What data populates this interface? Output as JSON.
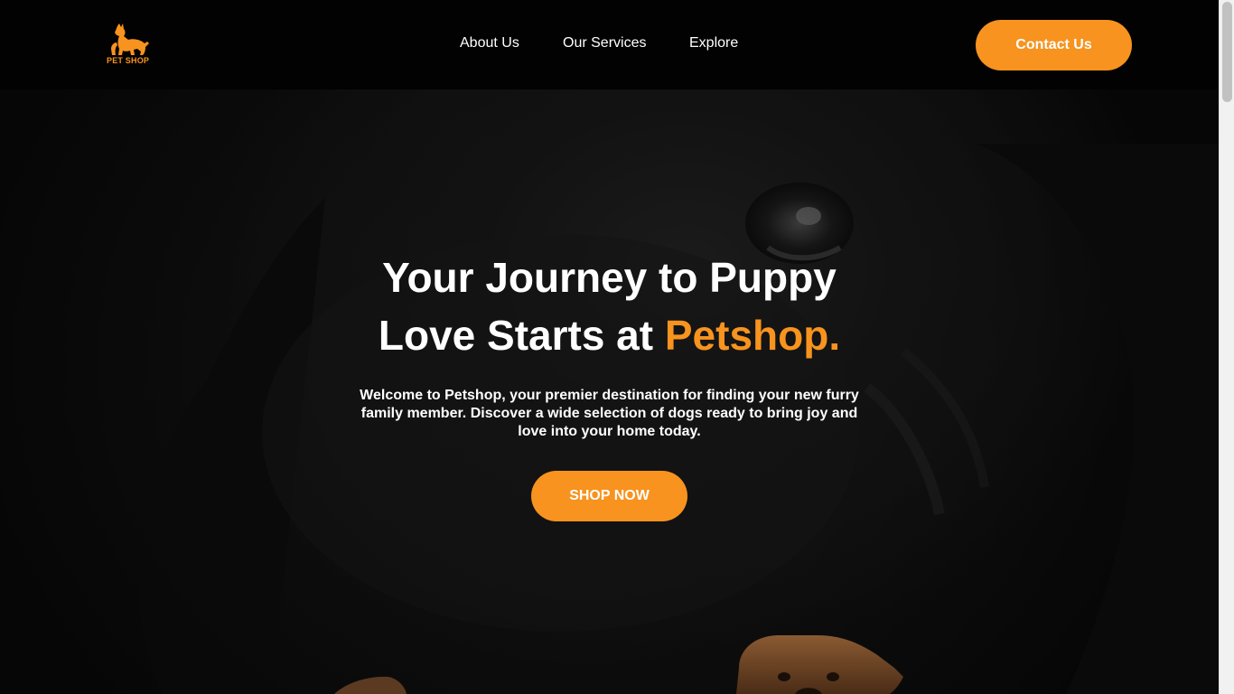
{
  "brand": {
    "logo_text": "PET SHOP",
    "accent": "#f7931e"
  },
  "nav": {
    "items": [
      {
        "label": "About Us"
      },
      {
        "label": "Our Services"
      },
      {
        "label": "Explore"
      }
    ],
    "contact_label": "Contact Us"
  },
  "hero": {
    "title_line1": "Your Journey to Puppy",
    "title_line2_prefix": "Love Starts at ",
    "title_highlight": "Petshop.",
    "description": "Welcome to Petshop, your premier destination for finding your new furry family member. Discover a wide selection of dogs ready to bring joy and love into your home today.",
    "cta_label": "SHOP NOW"
  },
  "icons": {
    "logo": "dog-and-cat-silhouette-icon"
  }
}
